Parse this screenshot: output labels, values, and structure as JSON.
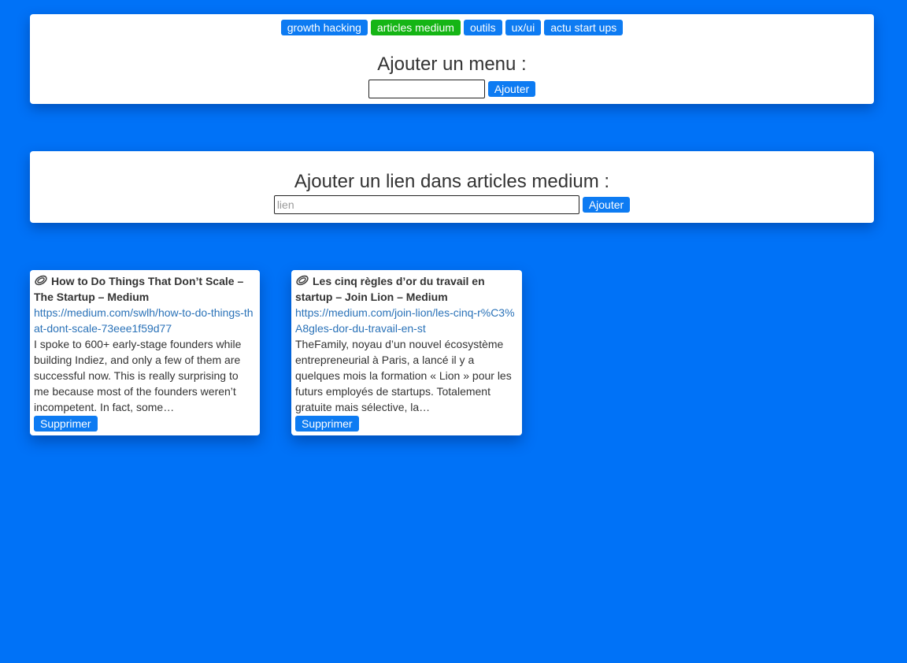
{
  "menu_panel": {
    "tabs": [
      {
        "label": "growth hacking",
        "active": false
      },
      {
        "label": "articles medium",
        "active": true
      },
      {
        "label": "outils",
        "active": false
      },
      {
        "label": "ux/ui",
        "active": false
      },
      {
        "label": "actu start ups",
        "active": false
      }
    ],
    "title": "Ajouter un menu :",
    "input_value": "",
    "submit_label": "Ajouter"
  },
  "link_panel": {
    "title": "Ajouter un lien dans articles medium :",
    "input_placeholder": "lien",
    "submit_label": "Ajouter"
  },
  "cards": [
    {
      "icon": "paperclip-icon",
      "title": "How to Do Things That Don’t Scale – The Startup – Medium",
      "url": "https://medium.com/swlh/how-to-do-things-that-dont-scale-73eee1f59d77",
      "description": "I spoke to 600+ early-stage founders while building Indiez, and only a few of them are successful now. This is really surprising to me because most of the founders weren’t incompetent. In fact, some…",
      "delete_label": "Supprimer"
    },
    {
      "icon": "paperclip-icon",
      "title": "Les cinq règles d’or du travail en startup – Join Lion – Medium",
      "url": "https://medium.com/join-lion/les-cinq-r%C3%A8gles-dor-du-travail-en-st",
      "description": "TheFamily, noyau d’un nouvel écosystème entrepreneurial à Paris, a lancé il y a quelques mois la formation « Lion » pour les futurs employés de startups. Totalement gratuite mais sélective, la…",
      "delete_label": "Supprimer"
    }
  ],
  "colors": {
    "background": "#0072f7",
    "button": "#0d7bf2",
    "active_tab": "#15b515",
    "link": "#2a72b8"
  }
}
